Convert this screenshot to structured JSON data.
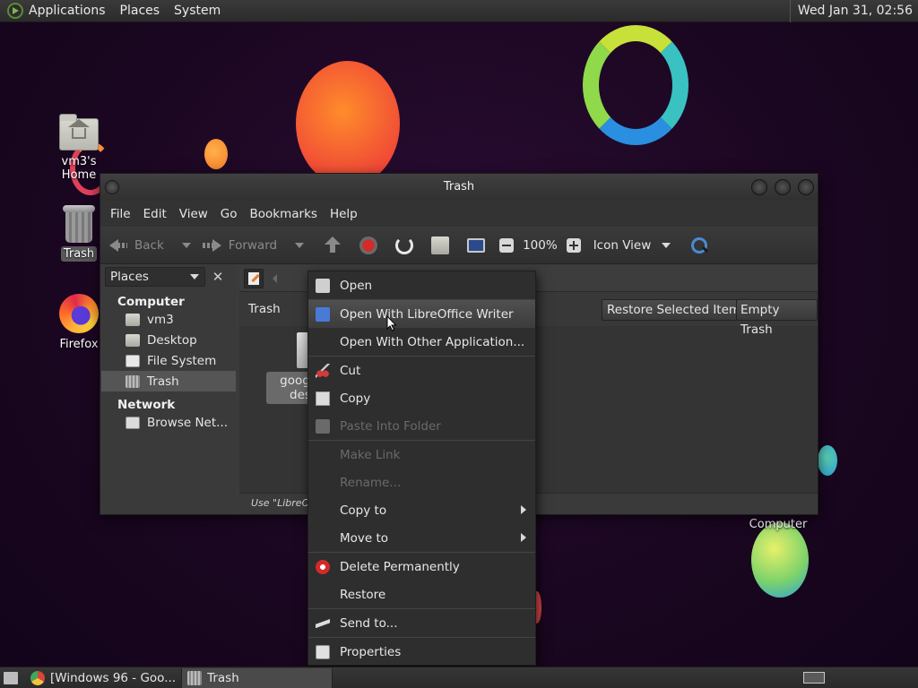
{
  "top_panel": {
    "menus": [
      "Applications",
      "Places",
      "System"
    ],
    "clock": "Wed Jan 31, 02:56"
  },
  "desktop_icons": {
    "home": "vm3's Home",
    "trash": "Trash",
    "firefox": "Firefox",
    "computer": "Computer"
  },
  "window": {
    "title": "Trash",
    "menubar": [
      "File",
      "Edit",
      "View",
      "Go",
      "Bookmarks",
      "Help"
    ],
    "toolbar": {
      "back": "Back",
      "forward": "Forward",
      "zoom": "100%",
      "view_mode": "Icon View"
    },
    "sidebar": {
      "selector": "Places",
      "sections": {
        "computer": "Computer",
        "network": "Network"
      },
      "items": [
        "vm3",
        "Desktop",
        "File System",
        "Trash",
        "Browse Net..."
      ]
    },
    "location": "Trash",
    "buttons": {
      "restore": "Restore Selected Items",
      "empty": "Empty Trash"
    },
    "file": {
      "name": "google-chrome.desktop",
      "visible_text": "google\ndes"
    },
    "status": "Use \"LibreOffice Writer\" to open the selected item"
  },
  "context_menu": {
    "items": [
      {
        "label": "Open",
        "icon": "folder-open-icon",
        "enabled": true
      },
      {
        "label": "Open With LibreOffice Writer",
        "icon": "writer-icon",
        "enabled": true,
        "hover": true
      },
      {
        "label": "Open With Other Application...",
        "icon": "",
        "enabled": true
      },
      {
        "label": "Cut",
        "icon": "scissors-icon",
        "enabled": true
      },
      {
        "label": "Copy",
        "icon": "copy-icon",
        "enabled": true
      },
      {
        "label": "Paste Into Folder",
        "icon": "paste-icon",
        "enabled": false
      },
      {
        "label": "Make Link",
        "icon": "",
        "enabled": false
      },
      {
        "label": "Rename...",
        "icon": "",
        "enabled": false
      },
      {
        "label": "Copy to",
        "icon": "",
        "enabled": true,
        "submenu": true
      },
      {
        "label": "Move to",
        "icon": "",
        "enabled": true,
        "submenu": true
      },
      {
        "label": "Delete Permanently",
        "icon": "delete-icon",
        "enabled": true
      },
      {
        "label": "Restore",
        "icon": "",
        "enabled": true
      },
      {
        "label": "Send to...",
        "icon": "send-icon",
        "enabled": true
      },
      {
        "label": "Properties",
        "icon": "properties-icon",
        "enabled": true
      }
    ]
  },
  "taskbar": {
    "tasks": [
      "[Windows 96 - Goo...",
      "Trash"
    ]
  },
  "colors": {
    "wallpaper": "#1a0620",
    "panel": "#2f2f2f",
    "menu_bg": "#2e2e2e",
    "accent_red": "#d42a2a"
  }
}
